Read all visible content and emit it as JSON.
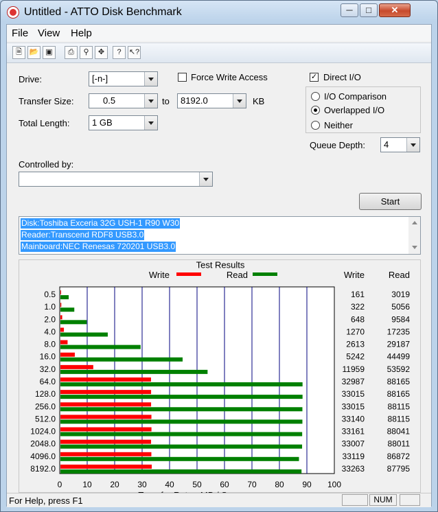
{
  "window": {
    "title": "Untitled - ATTO Disk Benchmark"
  },
  "menu": [
    "File",
    "View",
    "Help"
  ],
  "toolbar": [
    "new-icon",
    "open-icon",
    "save-icon",
    "print-icon",
    "print-preview-icon",
    "move-icon",
    "help-icon",
    "context-help-icon"
  ],
  "form": {
    "drive_label": "Drive:",
    "drive_value": "[-n-]",
    "transfer_label": "Transfer Size:",
    "transfer_from": "0.5",
    "to_label": "to",
    "transfer_to": "8192.0",
    "kb_label": "KB",
    "length_label": "Total Length:",
    "length_value": "1 GB",
    "force_write_label": "Force Write Access",
    "force_write_checked": false,
    "direct_io_label": "Direct I/O",
    "direct_io_checked": true,
    "radio_io_comparison": "I/O Comparison",
    "radio_overlapped": "Overlapped I/O",
    "radio_neither": "Neither",
    "radio_selected": "overlapped",
    "queue_label": "Queue Depth:",
    "queue_value": "4",
    "controlled_label": "Controlled by:",
    "controlled_value": "",
    "start_label": "Start"
  },
  "description": [
    "Disk:Toshiba Exceria 32G USH-1 R90 W30",
    "Reader:Transcend RDF8 USB3.0",
    "Mainboard:NEC Renesas 720201 USB3.0"
  ],
  "chart_data": {
    "type": "bar",
    "title": "Test Results",
    "xlabel": "Transfer Rate - MB / Sec",
    "xlim": [
      0,
      100
    ],
    "xticks": [
      "0",
      "10",
      "20",
      "30",
      "40",
      "50",
      "60",
      "70",
      "80",
      "90",
      "100"
    ],
    "categories": [
      "0.5",
      "1.0",
      "2.0",
      "4.0",
      "8.0",
      "16.0",
      "32.0",
      "64.0",
      "128.0",
      "256.0",
      "512.0",
      "1024.0",
      "2048.0",
      "4096.0",
      "8192.0"
    ],
    "series": [
      {
        "name": "Write",
        "color": "#ff0000",
        "values": [
          0.16,
          0.32,
          0.65,
          1.27,
          2.61,
          5.24,
          11.96,
          32.99,
          33.02,
          33.02,
          33.14,
          33.16,
          33.01,
          33.12,
          33.26
        ]
      },
      {
        "name": "Read",
        "color": "#008000",
        "values": [
          3.02,
          5.06,
          9.58,
          17.24,
          29.19,
          44.5,
          53.59,
          88.17,
          88.17,
          88.12,
          88.12,
          88.04,
          88.01,
          86.87,
          87.8
        ]
      }
    ],
    "table_headers": [
      "Write",
      "Read"
    ],
    "table": [
      [
        "161",
        "3019"
      ],
      [
        "322",
        "5056"
      ],
      [
        "648",
        "9584"
      ],
      [
        "1270",
        "17235"
      ],
      [
        "2613",
        "29187"
      ],
      [
        "5242",
        "44499"
      ],
      [
        "11959",
        "53592"
      ],
      [
        "32987",
        "88165"
      ],
      [
        "33015",
        "88165"
      ],
      [
        "33015",
        "88115"
      ],
      [
        "33140",
        "88115"
      ],
      [
        "33161",
        "88041"
      ],
      [
        "33007",
        "88011"
      ],
      [
        "33119",
        "86872"
      ],
      [
        "33263",
        "87795"
      ]
    ]
  },
  "status": {
    "help_text": "For Help, press F1",
    "num": "NUM"
  },
  "colors": {
    "write": "#ff0000",
    "read": "#008000",
    "grid": "#00007f",
    "selection": "#3399ff"
  }
}
